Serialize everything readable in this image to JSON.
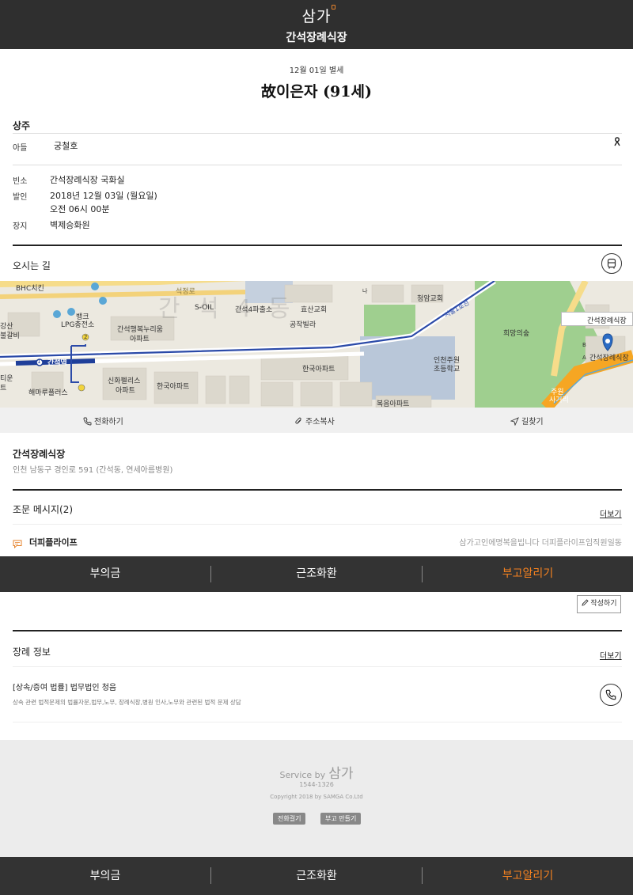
{
  "header": {
    "logo": "삼가",
    "hall": "간석장례식장"
  },
  "obituary": {
    "date": "12월 01일 별세",
    "name": "故이은자 (91세)"
  },
  "chief_mourners": {
    "title": "상주",
    "rows": [
      {
        "relation": "아들",
        "name": "궁철호"
      }
    ]
  },
  "details": {
    "room_label": "빈소",
    "room_value": "간석장례식장 국화실",
    "departure_label": "발인",
    "departure_date": "2018년 12월 03일 (월요일)",
    "departure_time": "오전 06시 00분",
    "burial_label": "장지",
    "burial_value": "벽제승화원"
  },
  "directions": {
    "title": "오시는 길"
  },
  "map": {
    "pin_label": "간석장례식장",
    "pin_sub": "간석장례식장",
    "watermark": "간 석 4 동",
    "labels": {
      "bhc": "BHC치킨",
      "seokjeongro": "석정로",
      "soil": "S-OIL",
      "ganseok4": "간석4파출소",
      "hyosan": "효산교회",
      "cheongam": "청암교회",
      "seoul_line": "서울1호선",
      "bank": "뱅크",
      "lpg": "LPG충전소",
      "gangsan": "강산",
      "bulgalbi": "불갈비",
      "haengbok": "간석행복누리움",
      "apt1": "아파트",
      "gongjak": "공작빌라",
      "station": "간석역",
      "hanguk1": "한국아파트",
      "incheon_elem_1": "인천주원",
      "incheon_elem_2": "초등학교",
      "sinhwa": "신화펠리스",
      "apt2": "아파트",
      "hanguk2": "한국아파트",
      "haemaru": "해마루플러스",
      "bokeum": "복음아파트",
      "huimang": "희망의숲",
      "juwon_1": "주원",
      "juwon_2": "사거리",
      "b": "B",
      "a": "A",
      "edge1": "티운",
      "edge2": "트",
      "num1": "1",
      "num2": "2",
      "dir_label": "나"
    }
  },
  "map_actions": {
    "call": "전화하기",
    "copy": "주소복사",
    "route": "길찾기"
  },
  "address": {
    "name": "간석장례식장",
    "line": "인천 남동구 경인로 591 (간석동, 연세아름병원)"
  },
  "messages": {
    "title": "조문 메시지(2)",
    "more": "더보기",
    "items": [
      {
        "author": "더피플라이프",
        "text": "삼가고인에명복을빕니다 더피플라이프임직원일동"
      }
    ]
  },
  "tabs": {
    "condolence_money": "부의금",
    "wreath": "근조화환",
    "notify": "부고알리기"
  },
  "write_button": "작성하기",
  "funeral_info": {
    "title": "장례 정보",
    "more": "더보기",
    "item_title": "[상속/증여 법률] 법무법인 청음",
    "item_desc": "상속 관련 법적문제의 법률자문,법무,노무, 장례식장,병원 인사,노무와 관련된 법적 문제 상담"
  },
  "footer": {
    "service_by": "Service by",
    "brand": "삼가",
    "phone": "1544-1326",
    "copyright": "Copyright 2018 by SAMGA Co.Ltd",
    "call_button": "전화걸기",
    "make_button": "부고 만들기"
  },
  "colors": {
    "accent": "#f58220",
    "dark": "#2f2f2f",
    "subway": "#1f3f9a"
  },
  "icons": [
    "ribbon-icon",
    "bus-icon",
    "phone-icon",
    "clip-icon",
    "navigate-icon",
    "message-icon",
    "pencil-icon",
    "map-pin-icon"
  ]
}
